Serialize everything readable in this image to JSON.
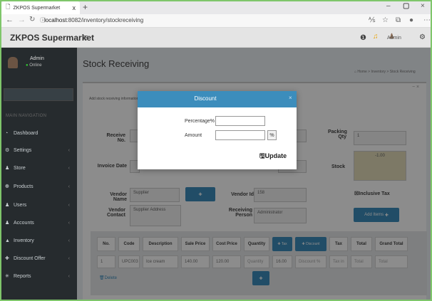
{
  "browser": {
    "tab_title": "ZKPOS Supermarket",
    "tab_close": "x",
    "new_tab": "+",
    "url_host": "localhost",
    "url_path": ":8082/inventory/stockreceiving"
  },
  "header": {
    "brand": "ZKPOS Supermarket",
    "user": "Admin",
    "notification_count": ""
  },
  "sidebar": {
    "user_name": "Admin",
    "user_status": "Online",
    "section": "MAIN NAVIGATION",
    "items": [
      {
        "label": "Dashboard",
        "icon": "dashboard-icon"
      },
      {
        "label": "Settings",
        "icon": "gear-icon"
      },
      {
        "label": "Store",
        "icon": "users-icon"
      },
      {
        "label": "Products",
        "icon": "products-icon"
      },
      {
        "label": "Users",
        "icon": "users-icon"
      },
      {
        "label": "Accounts",
        "icon": "accounts-icon"
      },
      {
        "label": "Inventory",
        "icon": "inventory-icon"
      },
      {
        "label": "Discount Offer",
        "icon": "plus-icon"
      },
      {
        "label": "Reports",
        "icon": "reports-icon"
      }
    ]
  },
  "page": {
    "title": "Stock Receiving",
    "breadcrumb_home": "Home",
    "breadcrumb_1": "Inventory",
    "breadcrumb_2": "Stock Receiving",
    "hint": "Add stock receiving information",
    "box_tools": "− ×"
  },
  "form": {
    "receive_no_label": "Receive No.",
    "invoice_date_label": "Invoice Date",
    "vendor_name_label": "Vendor Name",
    "vendor_name_placeholder": "Supplier",
    "vendor_contact_label_1": "Vendor",
    "vendor_contact_label_2": "Contact",
    "vendor_contact_placeholder": "Supplier Address",
    "vendor_id_label": "Vendor Id",
    "vendor_id_value": "158",
    "receiving_person_label_1": "Receiving",
    "receiving_person_label_2": "Person",
    "receiving_person_value": "Administrator",
    "packing_qty_label_1": "Packing",
    "packing_qty_label_2": "Qty",
    "packing_qty_value": "1",
    "stock_label": "Stock",
    "stock_value": "-1.00",
    "inclusive_tax_label": "Inclusive Tax",
    "add_items_label": "Add Items"
  },
  "table": {
    "headers": [
      "No.",
      "Code",
      "Description",
      "Sale Price",
      "Cost Price",
      "Quantity"
    ],
    "tax_btn": "Tax",
    "discount_btn": "Discount",
    "headers2": [
      "Tax",
      "Total",
      "Grand Total"
    ],
    "row": {
      "no": "1",
      "code": "UPC003",
      "description": "Ice cream",
      "sale_price": "140.00",
      "cost_price": "120.00",
      "quantity_placeholder": "Quantity",
      "quantity_value": "16.00",
      "discount_placeholder": "Discount %",
      "tax_placeholder": "Tax in",
      "total_placeholder": "Total",
      "grand_total_placeholder": "Total"
    },
    "delete_label": "Delete"
  },
  "modal": {
    "title": "Discount",
    "percentage_label": "Percentage%",
    "amount_label": "Amount",
    "percent_button": "%",
    "update_label": "Update",
    "close": "×"
  }
}
